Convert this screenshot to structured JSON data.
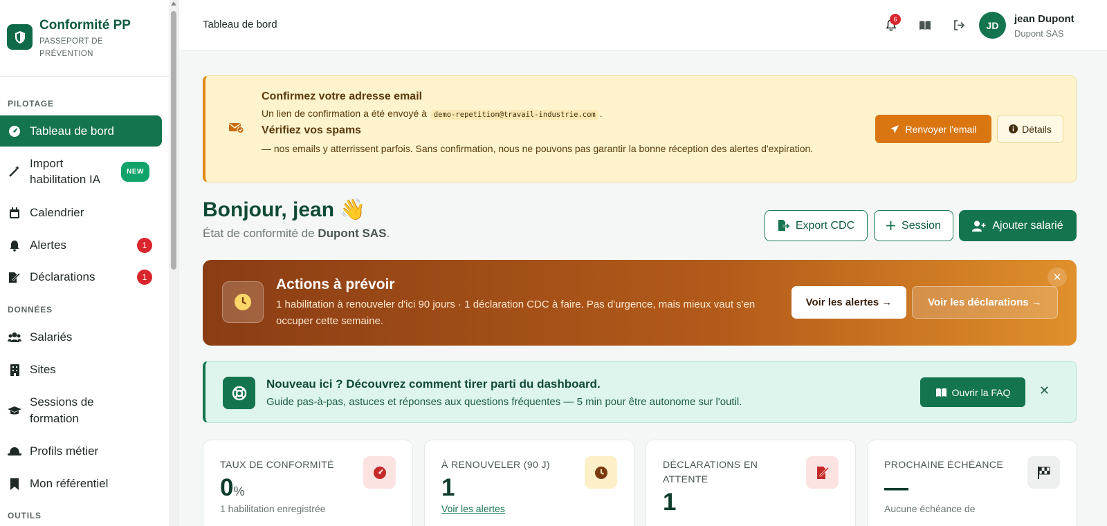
{
  "brand": {
    "title": "Conformité PP",
    "subtitle_line1": "PASSEPORT DE",
    "subtitle_line2": "PRÉVENTION"
  },
  "sidebar": {
    "sections": {
      "pilotage": "PILOTAGE",
      "donnees": "DONNÉES",
      "outils": "OUTILS"
    },
    "items": [
      {
        "label": "Tableau de bord",
        "icon": "gauge-icon"
      },
      {
        "label_line1": "Import",
        "label_line2": "habilitation IA",
        "badge": "NEW",
        "icon": "magic-wand-icon"
      },
      {
        "label": "Calendrier",
        "icon": "calendar-icon"
      },
      {
        "label": "Alertes",
        "badge": "1",
        "icon": "bell-icon"
      },
      {
        "label": "Déclarations",
        "badge": "1",
        "icon": "file-signature-icon"
      },
      {
        "label": "Salariés",
        "icon": "users-icon"
      },
      {
        "label": "Sites",
        "icon": "building-icon"
      },
      {
        "label_line1": "Sessions de",
        "label_line2": "formation",
        "icon": "graduation-cap-icon"
      },
      {
        "label": "Profils métier",
        "icon": "hard-hat-icon"
      },
      {
        "label": "Mon référentiel",
        "icon": "bookmark-icon"
      }
    ]
  },
  "topbar": {
    "title": "Tableau de bord",
    "notifications": "6",
    "user": {
      "initials": "JD",
      "name": "jean Dupont",
      "company": "Dupont SAS"
    }
  },
  "email_banner": {
    "title": "Confirmez votre adresse email",
    "line1_prefix": "Un lien de confirmation a été envoyé à",
    "email": "demo-repetition@travail-industrie.com",
    "line1_suffix": ".",
    "subtitle": "Vérifiez vos spams",
    "line2": "— nos emails y atterrissent parfois. Sans confirmation, nous ne pouvons pas garantir la bonne réception des alertes d'expiration.",
    "resend_label": "Renvoyer l'email",
    "details_label": "Détails"
  },
  "greeting": {
    "title": "Bonjour, jean 👋",
    "sub_prefix": "État de conformité de",
    "company": "Dupont SAS",
    "sub_suffix": "."
  },
  "actions_toolbar": {
    "export": "Export CDC",
    "session": "Session",
    "add": "Ajouter salarié"
  },
  "actions_banner": {
    "title": "Actions à prévoir",
    "text": "1 habilitation à renouveler d'ici 90 jours · 1 déclaration CDC à faire. Pas d'urgence, mais mieux vaut s'en occuper cette semaine.",
    "btn_alerts": "Voir les alertes →",
    "btn_declarations": "Voir les déclarations →"
  },
  "faq_banner": {
    "title": "Nouveau ici ? Découvrez comment tirer parti du dashboard.",
    "text": "Guide pas-à-pas, astuces et réponses aux questions fréquentes — 5 min pour être autonome sur l'outil.",
    "button": "Ouvrir la FAQ"
  },
  "stats": [
    {
      "label": "TAUX DE CONFORMITÉ",
      "value": "0",
      "unit": "%",
      "foot": "1 habilitation enregistrée",
      "icon": "gauge-icon",
      "color": "#fde2e2"
    },
    {
      "label": "À RENOUVELER (90 J)",
      "value": "1",
      "link": "Voir les alertes",
      "icon": "clock-icon",
      "color": "#fdf0c8"
    },
    {
      "label": "DÉCLARATIONS EN ATTENTE",
      "value": "1",
      "icon": "file-signature-icon",
      "color": "#fde2e2"
    },
    {
      "label": "PROCHAINE ÉCHÉANCE",
      "value": "—",
      "foot": "Aucune échéance de",
      "icon": "checkered-flag-icon",
      "color": "#eef0ef"
    }
  ]
}
